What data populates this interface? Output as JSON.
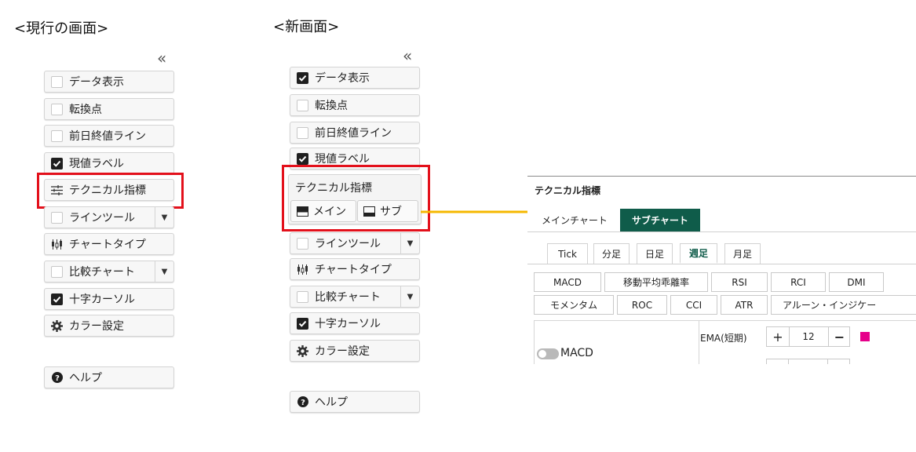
{
  "headings": {
    "current": "<現行の画面>",
    "new": "<新画面>"
  },
  "collapse_glyph": "«",
  "current_panel": {
    "data_display": "データ表示",
    "turning_point": "転換点",
    "prev_close_line": "前日終値ライン",
    "current_label": "現値ラベル",
    "technical": "テクニカル指標",
    "line_tool": "ラインツール",
    "chart_type": "チャートタイプ",
    "compare_chart": "比較チャート",
    "crosshair": "十字カーソル",
    "color_settings": "カラー設定",
    "help": "ヘルプ"
  },
  "new_panel": {
    "data_display": "データ表示",
    "turning_point": "転換点",
    "prev_close_line": "前日終値ライン",
    "current_label": "現値ラベル",
    "technical_title": "テクニカル指標",
    "main": "メイン",
    "sub": "サブ",
    "line_tool": "ラインツール",
    "chart_type": "チャートタイプ",
    "compare_chart": "比較チャート",
    "crosshair": "十字カーソル",
    "color_settings": "カラー設定",
    "help": "ヘルプ"
  },
  "dialog": {
    "title": "テクニカル指標",
    "tabs": [
      "メインチャート",
      "サブチャート"
    ],
    "period_tabs": [
      "Tick",
      "分足",
      "日足",
      "週足",
      "月足"
    ],
    "indicators_row1": [
      "MACD",
      "移動平均乖離率",
      "RSI",
      "RCI",
      "DMI"
    ],
    "indicators_row2": [
      "モメンタム",
      "ROC",
      "CCI",
      "ATR",
      "アルーン・インジケー"
    ],
    "setting_name": "MACD",
    "param_label": "EMA(短期)",
    "param_value": "12",
    "plus": "+",
    "minus": "−"
  },
  "colors": {
    "accent": "#0f5c4a",
    "highlight": "#e3101b",
    "arrow": "#f5b800",
    "swatch": "#e6008a"
  }
}
